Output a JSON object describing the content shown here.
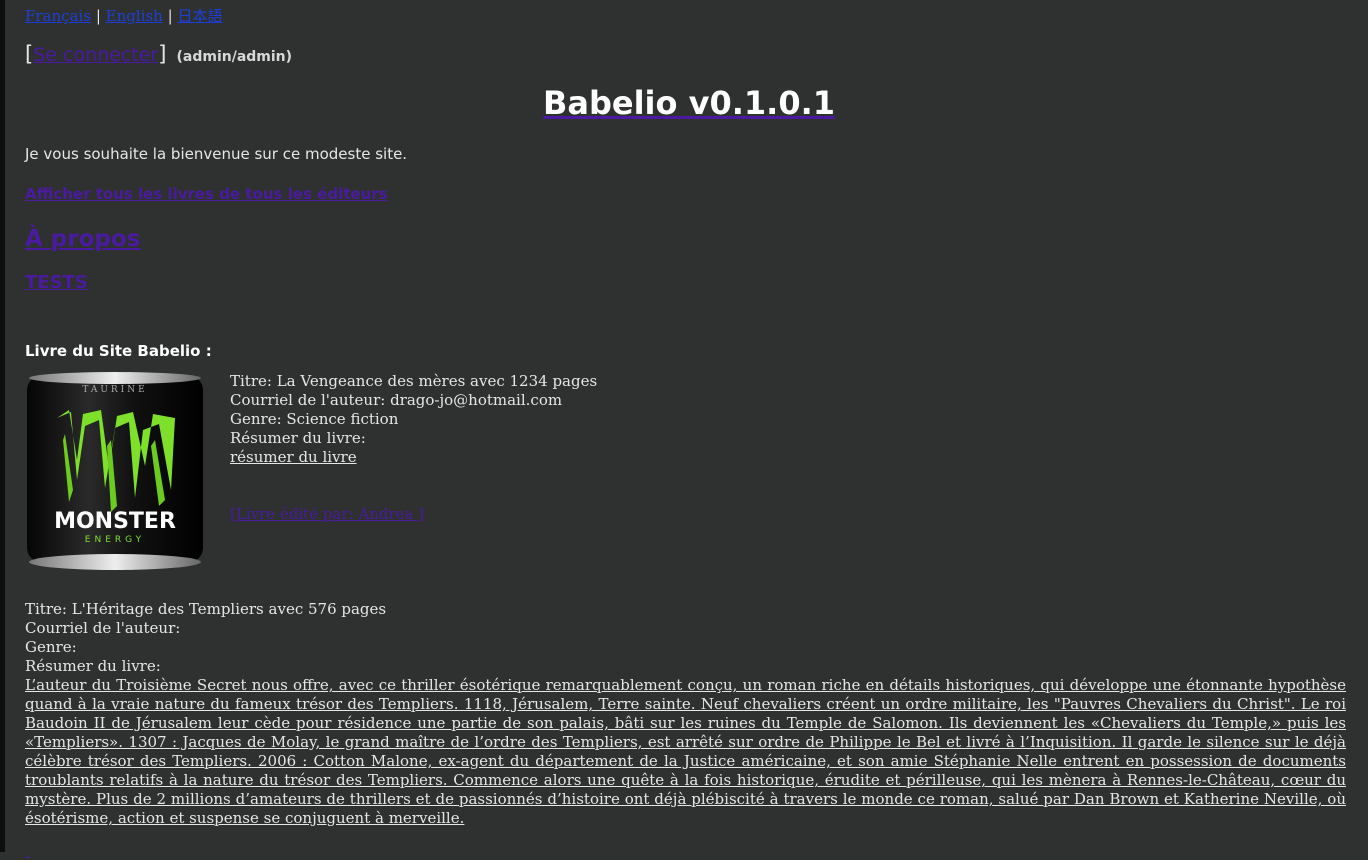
{
  "lang": {
    "fr": "Français",
    "en": "English",
    "ja": "日本語",
    "sep": "|"
  },
  "login": {
    "link": "Se connecter",
    "open": "[",
    "close": "]",
    "creds": "(admin/admin)"
  },
  "title": "Babelio v0.1.0.1",
  "welcome": "Je vous souhaite la bienvenue sur ce modeste site.",
  "nav": {
    "all_books": "Afficher tous les livres de tous les éditeurs",
    "about": "À propos",
    "tests": "TESTS"
  },
  "section_title": "Livre du Site Babelio :",
  "book1": {
    "cover_brand": "MONSTER",
    "cover_sub": "ENERGY",
    "titre": "Titre: La Vengeance des mères avec 1234 pages",
    "courriel": "Courriel de l'auteur: drago-jo@hotmail.com",
    "genre": "Genre: Science fiction",
    "resumer_label": "Résumer du livre:",
    "resumer_link": "résumer du livre",
    "edited_by": "[Livre édité par: Andrea ]"
  },
  "book2": {
    "titre": "Titre: L'Héritage des Templiers avec 576 pages",
    "courriel": "Courriel de l'auteur:",
    "genre": "Genre:",
    "resumer_label": "Résumer du livre:",
    "summary": "L’auteur du Troisième Secret nous offre, avec ce thriller ésotérique remarquablement conçu, un roman riche en détails historiques, qui développe une étonnante hypothèse quand à la vraie nature du fameux trésor des Templiers. 1118, Jérusalem, Terre sainte. Neuf chevaliers créent un ordre militaire, les \"Pauvres Chevaliers du Christ\". Le roi Baudoin II de Jérusalem leur cède pour résidence une partie de son palais, bâti sur les ruines du Temple de Salomon. Ils deviennent les «Chevaliers du Temple,» puis les «Templiers». 1307 : Jacques de Molay, le grand maître de l’ordre des Templiers, est arrêté sur ordre de Philippe le Bel et livré à l’Inquisition. Il garde le silence sur le déjà célèbre trésor des Templiers. 2006 : Cotton Malone, ex-agent du département de la Justice américaine, et son amie Stéphanie Nelle entrent en possession de documents troublants relatifs à la nature du trésor des Templiers. Commence alors une quête à la fois historique, érudite et périlleuse, qui les mènera à Rennes-le-Château, cœur du mystère. Plus de 2 millions d’amateurs de thrillers et de passionnés d’histoire ont déjà plébiscité à travers le monde ce roman, salué par Dan Brown et Katherine Neville, où ésotérisme, action et suspense se conjuguent à merveille."
  },
  "colors": {
    "background": "#2f3131",
    "link": "#4a1aa0",
    "lang_link": "#1d3fd6",
    "text": "#e6e6e6"
  },
  "icons": {
    "cover": "monster-energy-can-image"
  }
}
